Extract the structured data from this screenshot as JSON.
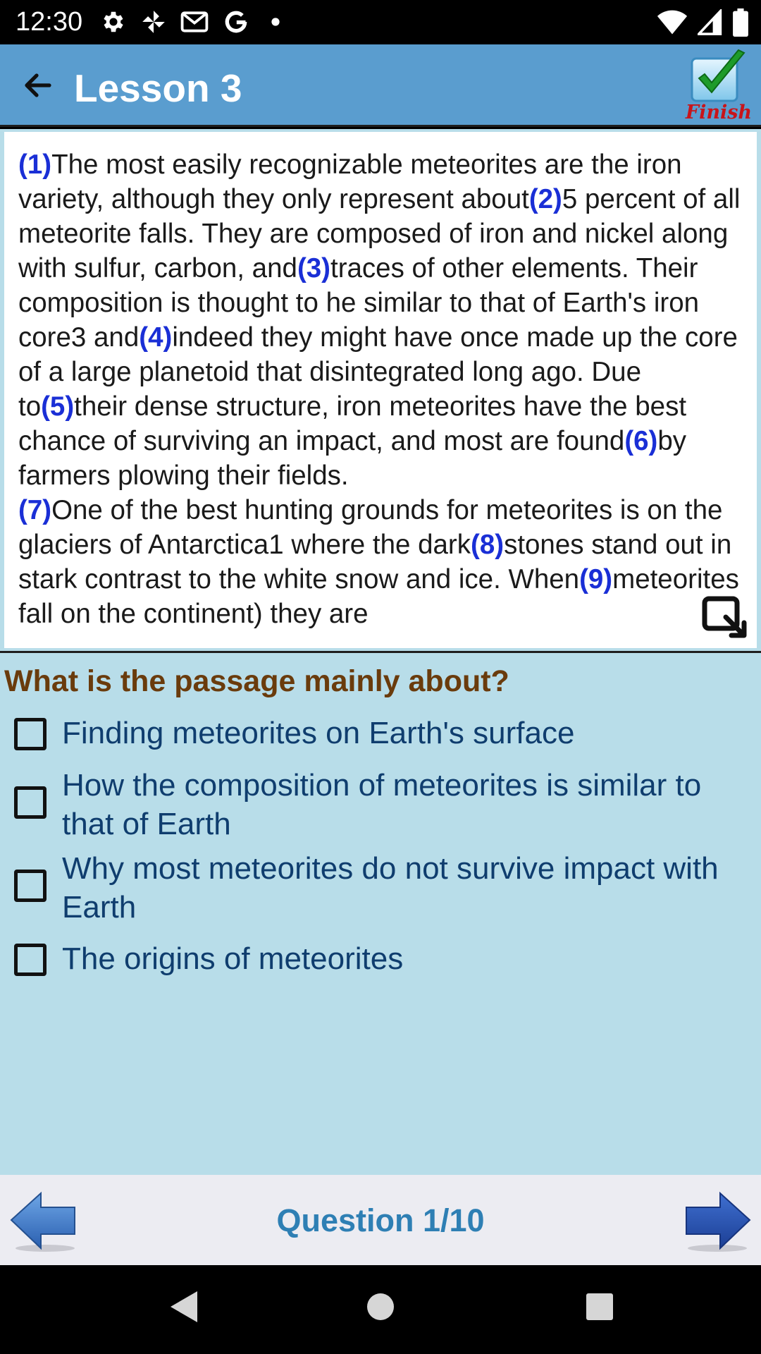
{
  "status_bar": {
    "time": "12:30",
    "left_icons": [
      "gear-icon",
      "pinwheel-icon",
      "gmail-icon",
      "google-icon",
      "dot-icon"
    ],
    "right_icons": [
      "wifi-icon",
      "signal-icon",
      "battery-icon"
    ]
  },
  "app_bar": {
    "title": "Lesson 3",
    "finish_label": "Finish"
  },
  "passage": {
    "segments": [
      {
        "type": "num",
        "text": "(1)"
      },
      {
        "type": "text",
        "text": "The most easily recognizable meteorites are the iron variety, although they only represent about"
      },
      {
        "type": "num",
        "text": "(2)"
      },
      {
        "type": "text",
        "text": "5 percent of all meteorite falls. They are composed of iron and nickel along with sulfur, carbon, and"
      },
      {
        "type": "num",
        "text": "(3)"
      },
      {
        "type": "text",
        "text": "traces of other elements. Their composition is thought to he similar to that of Earth's iron core3 and"
      },
      {
        "type": "num",
        "text": "(4)"
      },
      {
        "type": "text",
        "text": "indeed they might have once made up the core of a large planetoid that disintegrated long ago. Due to"
      },
      {
        "type": "num",
        "text": "(5)"
      },
      {
        "type": "text",
        "text": "their dense structure, iron meteorites have the best chance of surviving an impact, and most are found"
      },
      {
        "type": "num",
        "text": "(6)"
      },
      {
        "type": "text",
        "text": "by farmers plowing their fields."
      },
      {
        "type": "break"
      },
      {
        "type": "num",
        "text": "(7)"
      },
      {
        "type": "text",
        "text": "One of the best hunting grounds for meteorites is on the glaciers of Antarctica1 where the dark"
      },
      {
        "type": "num",
        "text": "(8)"
      },
      {
        "type": "text",
        "text": "stones stand out in stark contrast to the white snow and ice. When"
      },
      {
        "type": "num",
        "text": "(9)"
      },
      {
        "type": "text",
        "text": "meteorites fall on the continent) they are"
      }
    ]
  },
  "question": {
    "text": "What is the passage mainly about?",
    "options": [
      {
        "label": "Finding meteorites on Earth's surface",
        "checked": false
      },
      {
        "label": "How the composition of meteorites is similar to that of Earth",
        "checked": false
      },
      {
        "label": "Why most meteorites do not survive impact with Earth",
        "checked": false
      },
      {
        "label": "The origins of meteorites",
        "checked": false
      }
    ]
  },
  "bottom_nav": {
    "counter": "Question 1/10"
  },
  "colors": {
    "app_bar": "#5a9dcf",
    "question_bg": "#b8dde9",
    "number_blue": "#1a2fd6",
    "question_brown": "#6a3b0c",
    "option_text": "#0f3d6e",
    "counter_blue": "#2e7fb4",
    "finish_red": "#c8141a"
  }
}
